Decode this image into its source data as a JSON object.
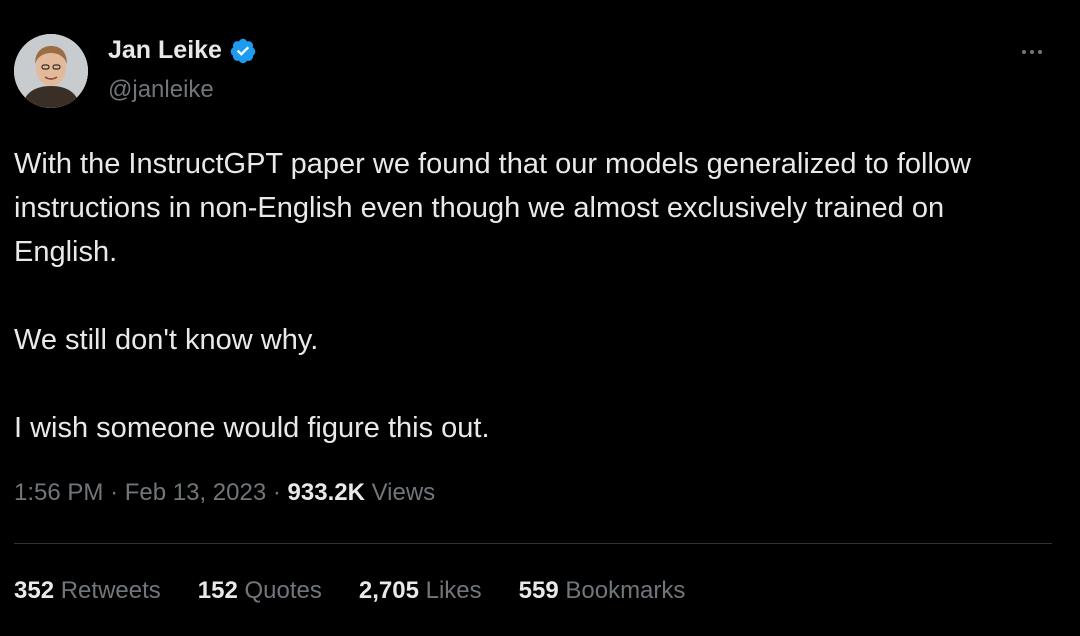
{
  "author": {
    "name": "Jan Leike",
    "handle": "@janleike",
    "verified": true,
    "verified_color": "#1d9bf0"
  },
  "tweet": {
    "paragraphs": [
      "With the InstructGPT paper we found that our models generalized to follow instructions in non-English even though we almost exclusively trained on English.",
      "We still don't know why.",
      "I wish someone would figure this out."
    ]
  },
  "meta": {
    "time": "1:56 PM",
    "separator": "·",
    "date": "Feb 13, 2023",
    "views_count": "933.2K",
    "views_label": "Views"
  },
  "stats": [
    {
      "count": "352",
      "label": "Retweets"
    },
    {
      "count": "152",
      "label": "Quotes"
    },
    {
      "count": "2,705",
      "label": "Likes"
    },
    {
      "count": "559",
      "label": "Bookmarks"
    }
  ],
  "icons": {
    "more": "more-horizontal-icon",
    "verified": "verified-badge-icon"
  },
  "colors": {
    "background": "#000000",
    "text_primary": "#e7e9ea",
    "text_secondary": "#71767b",
    "divider": "#2f3336"
  }
}
